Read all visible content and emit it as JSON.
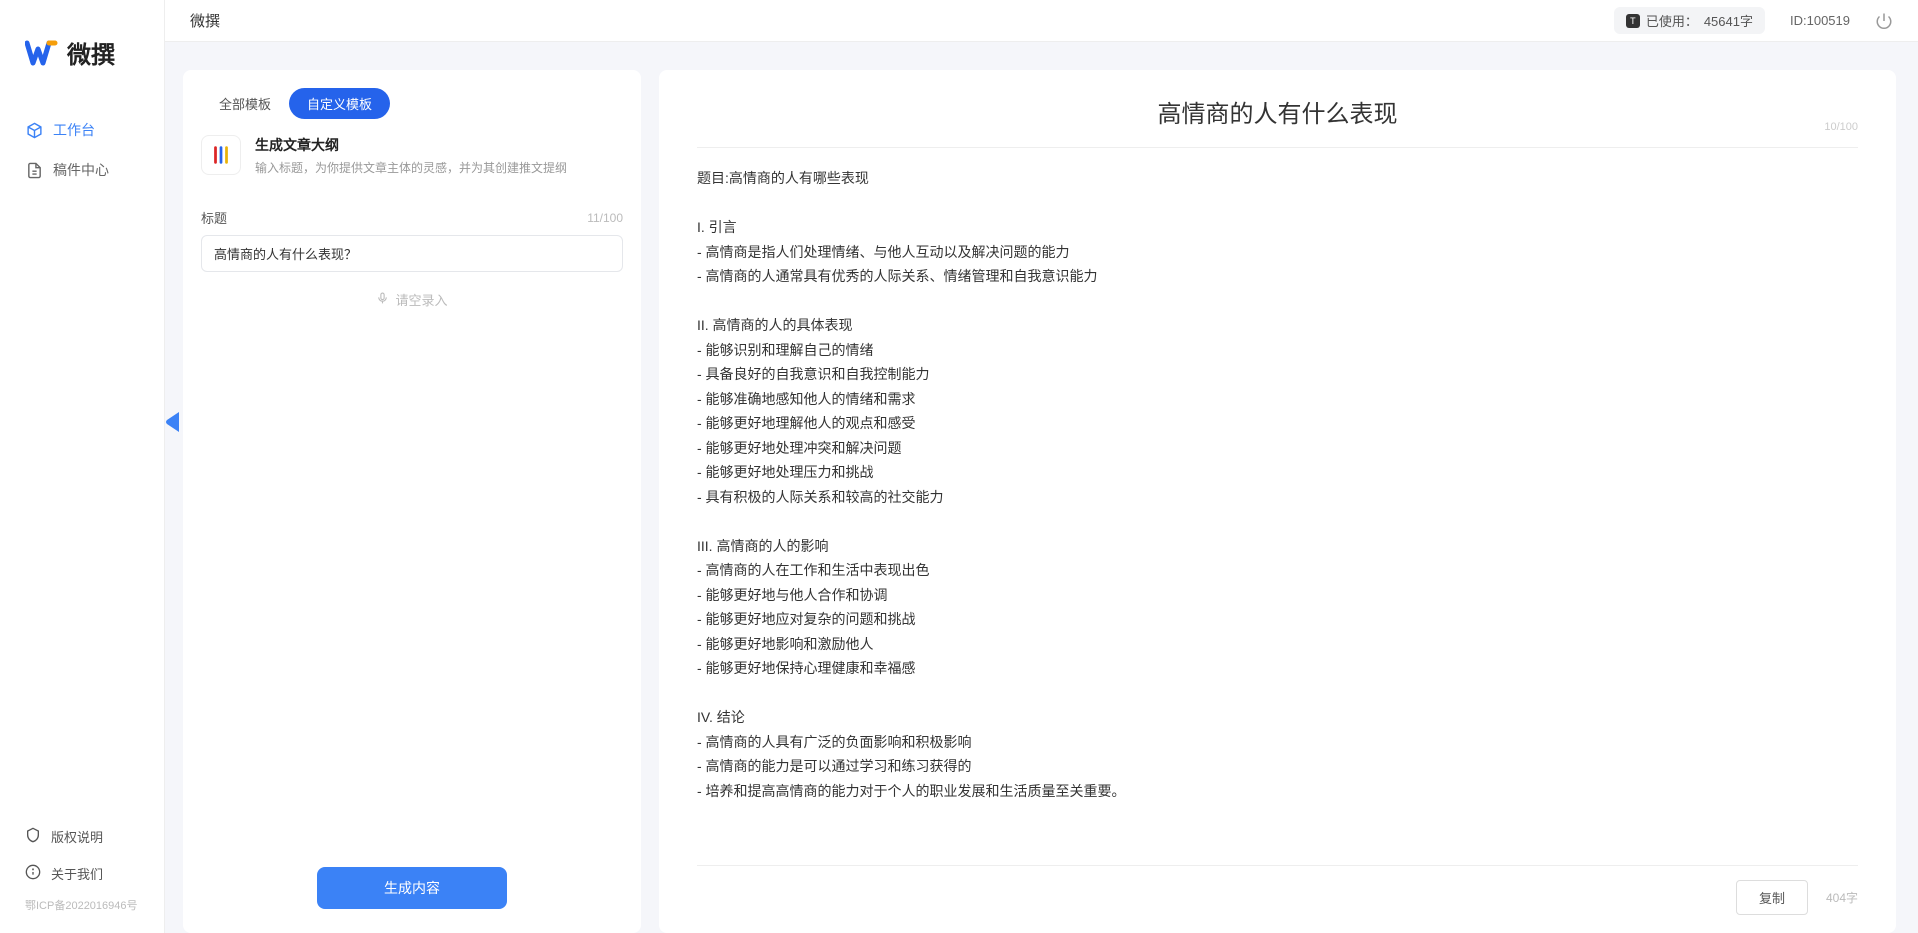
{
  "app": {
    "logoText": "微撰",
    "title": "微撰"
  },
  "sidebar": {
    "nav": [
      {
        "label": "工作台",
        "icon": "cube"
      },
      {
        "label": "稿件中心",
        "icon": "document"
      }
    ],
    "footer": [
      {
        "label": "版权说明",
        "icon": "shield"
      },
      {
        "label": "关于我们",
        "icon": "info"
      }
    ],
    "icp": "鄂ICP备2022016946号"
  },
  "topbar": {
    "usageLabel": "已使用：",
    "usageValue": "45641字",
    "userIdLabel": "ID:",
    "userId": "100519"
  },
  "leftPanel": {
    "tabs": [
      {
        "label": "全部模板",
        "active": false
      },
      {
        "label": "自定义模板",
        "active": true
      }
    ],
    "template": {
      "title": "生成文章大纲",
      "desc": "输入标题，为你提供文章主体的灵感，并为其创建推文提纲"
    },
    "form": {
      "titleLabel": "标题",
      "titleCount": "11/100",
      "titleValue": "高情商的人有什么表现？",
      "voicePlaceholder": "请空录入"
    },
    "generateBtn": "生成内容"
  },
  "rightPanel": {
    "title": "高情商的人有什么表现",
    "titleCount": "10/100",
    "body": "题目:高情商的人有哪些表现\n\nI. 引言\n- 高情商是指人们处理情绪、与他人互动以及解决问题的能力\n- 高情商的人通常具有优秀的人际关系、情绪管理和自我意识能力\n\nII. 高情商的人的具体表现\n- 能够识别和理解自己的情绪\n- 具备良好的自我意识和自我控制能力\n- 能够准确地感知他人的情绪和需求\n- 能够更好地理解他人的观点和感受\n- 能够更好地处理冲突和解决问题\n- 能够更好地处理压力和挑战\n- 具有积极的人际关系和较高的社交能力\n\nIII. 高情商的人的影响\n- 高情商的人在工作和生活中表现出色\n- 能够更好地与他人合作和协调\n- 能够更好地应对复杂的问题和挑战\n- 能够更好地影响和激励他人\n- 能够更好地保持心理健康和幸福感\n\nIV. 结论\n- 高情商的人具有广泛的负面影响和积极影响\n- 高情商的能力是可以通过学习和练习获得的\n- 培养和提高高情商的能力对于个人的职业发展和生活质量至关重要。",
    "copyBtn": "复制",
    "wordCount": "404字"
  }
}
